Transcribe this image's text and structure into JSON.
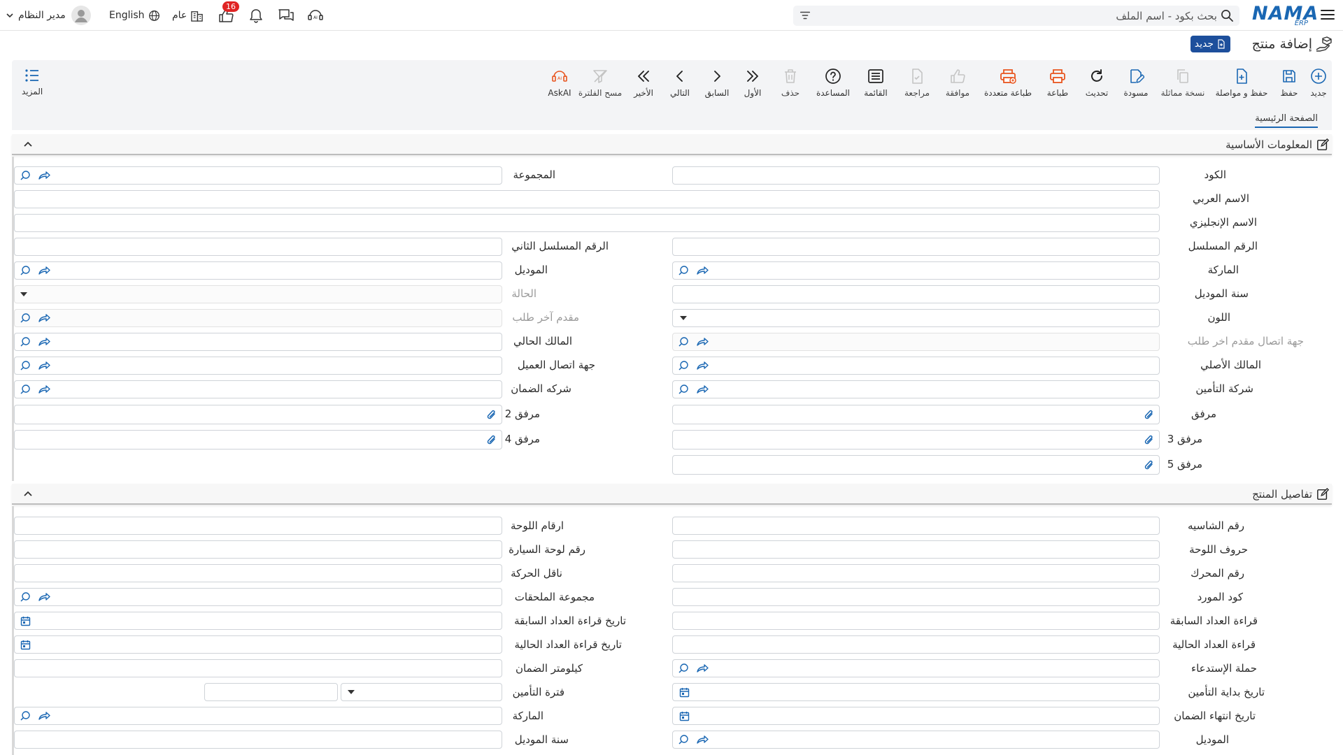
{
  "header": {
    "logo_text": "NAMA",
    "logo_sub": "ERP",
    "search_placeholder": "بحث بكود - اسم الملف",
    "language": "English",
    "user_name": "مدير النظام",
    "general_label": "عام",
    "notification_count": "16"
  },
  "page": {
    "title": "إضافة منتج",
    "new_badge": "جديد"
  },
  "toolbar": {
    "new": "جديد",
    "save": "حفظ",
    "save_continue": "حفظ و مواصلة",
    "duplicate": "نسخة مماثلة",
    "draft": "مسودة",
    "refresh": "تحديث",
    "print": "طباعة",
    "multi_print": "طباعة متعددة",
    "approve": "موافقة",
    "review": "مراجعة",
    "list": "القائمة",
    "help": "المساعدة",
    "delete": "حذف",
    "first": "الأول",
    "previous": "السابق",
    "next": "التالي",
    "last": "الأخير",
    "clear_filter": "مسح الفلترة",
    "askai": "AskAI",
    "more": "المزيد"
  },
  "tabs": {
    "main": "الصفحة الرئيسية"
  },
  "sections": {
    "basic": "المعلومات الأساسية",
    "details": "تفاصيل المنتج"
  },
  "basic_fields": {
    "code": "الكود",
    "group": "المجموعة",
    "arabic_name": "الاسم العربي",
    "english_name": "الاسم الإنجليزي",
    "serial": "الرقم المسلسل",
    "serial2": "الرقم المسلسل الثاني",
    "brand": "الماركة",
    "model": "الموديل",
    "model_year": "سنة الموديل",
    "status": "الحالة",
    "color": "اللون",
    "last_requester": "مقدم آخر طلب",
    "last_requester_contact": "جهة اتصال مقدم اخر طلب",
    "current_owner": "المالك الحالي",
    "original_owner": "المالك الأصلي",
    "customer_contact": "جهة اتصال العميل",
    "insurance_company": "شركة التأمين",
    "warranty_company": "شركه الضمان",
    "attachment": "مرفق",
    "attachment2": "مرفق 2",
    "attachment3": "مرفق 3",
    "attachment4": "مرفق 4",
    "attachment5": "مرفق 5"
  },
  "detail_fields": {
    "chassis": "رقم الشاسيه",
    "plate_numbers": "ارقام اللوحة",
    "plate_letters": "حروف اللوحة",
    "car_plate": "رقم لوحة السيارة",
    "engine": "رقم المحرك",
    "transmission": "ناقل الحركة",
    "supplier_code": "كود المورد",
    "accessories_group": "مجموعة الملحقات",
    "prev_meter": "قراءة العداد السابقة",
    "prev_meter_date": "تاريخ قراءة العداد السابقة",
    "curr_meter": "قراءة العداد الحالية",
    "curr_meter_date": "تاريخ قراءة العداد الحالية",
    "recall": "حملة الإستدعاء",
    "warranty_km": "كيلومتر الضمان",
    "insurance_start": "تاريخ بداية التأمين",
    "insurance_period": "فترة التأمين",
    "warranty_end": "تاريخ انتهاء الضمان",
    "brand": "الماركة",
    "model": "الموديل",
    "model_year": "سنة الموديل"
  },
  "colors": {
    "accent": "#1a67b3",
    "badge_bg": "#1d4f9c",
    "print_icon": "#e8541e",
    "notification": "#e02424"
  }
}
